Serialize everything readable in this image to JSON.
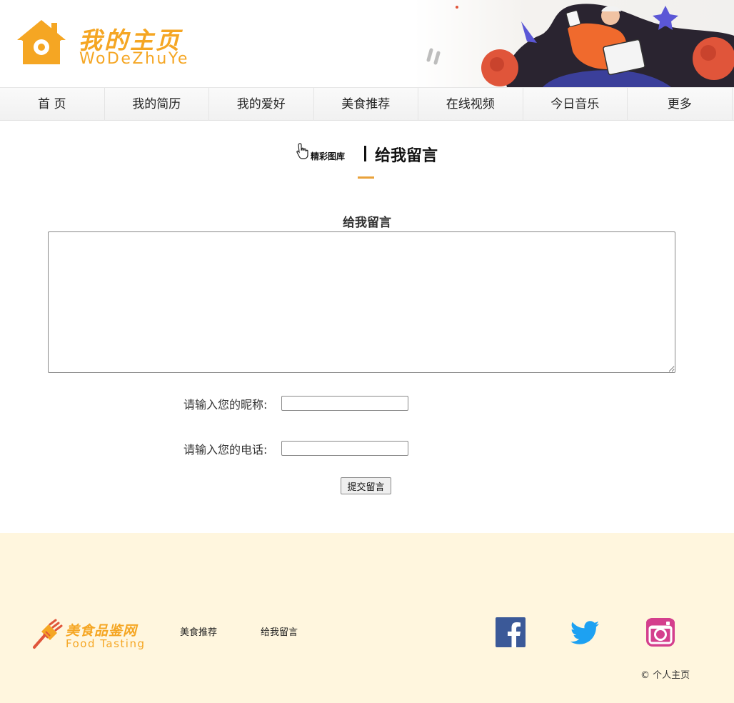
{
  "header": {
    "logo_title": "我的主页",
    "logo_subtitle": "WoDeZhuYe",
    "accent": "#f5a623"
  },
  "nav": {
    "items": [
      "首 页",
      "我的简历",
      "我的爱好",
      "美食推荐",
      "在线视频",
      "今日音乐",
      "更多"
    ]
  },
  "section": {
    "gallery_link": "精彩图库",
    "title": "给我留言",
    "underline_color": "#e9a23b"
  },
  "form": {
    "heading": "给我留言",
    "message_value": "",
    "nickname_label": "请输入您的昵称:",
    "nickname_value": "",
    "phone_label": "请输入您的电话:",
    "phone_value": "",
    "submit_label": "提交留言"
  },
  "footer": {
    "logo_cn": "美食品鉴网",
    "logo_en": "Food Tasting",
    "links": [
      "美食推荐",
      "给我留言"
    ],
    "social": [
      "facebook-icon",
      "twitter-icon",
      "instagram-icon"
    ],
    "copyright": "© 个人主页",
    "background": "#fff6de"
  }
}
